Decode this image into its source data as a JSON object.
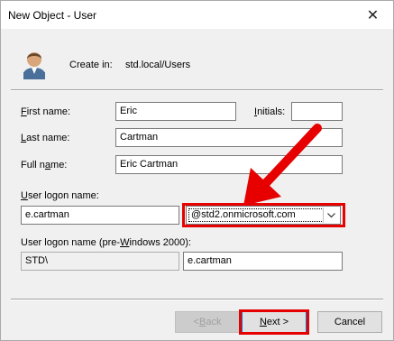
{
  "window": {
    "title": "New Object - User",
    "close_label": "✕"
  },
  "header": {
    "create_in_label": "Create in:",
    "create_in_path": "std.local/Users"
  },
  "form": {
    "first_name": {
      "label_key": "F",
      "label_rest": "irst name:",
      "value": "Eric"
    },
    "initials": {
      "label_key": "I",
      "label_rest": "nitials:",
      "value": ""
    },
    "last_name": {
      "label_key": "L",
      "label_rest": "ast name:",
      "value": "Cartman"
    },
    "full_name": {
      "label_pre": "Full n",
      "label_key": "a",
      "label_rest": "me:",
      "value": "Eric Cartman"
    },
    "logon": {
      "label_key": "U",
      "label_rest": "ser logon name:",
      "value": "e.cartman",
      "domain": "@std2.onmicrosoft.com"
    },
    "pre2000": {
      "label_pre": "User logon name (pre-",
      "label_key": "W",
      "label_rest": "indows 2000):",
      "domain": "STD\\",
      "value": "e.cartman"
    }
  },
  "buttons": {
    "back": {
      "pre": "< ",
      "key": "B",
      "rest": "ack"
    },
    "next": {
      "key": "N",
      "rest": "ext >"
    },
    "cancel": "Cancel"
  },
  "colors": {
    "annotation": "#e60000",
    "focus": "#0078d7"
  }
}
